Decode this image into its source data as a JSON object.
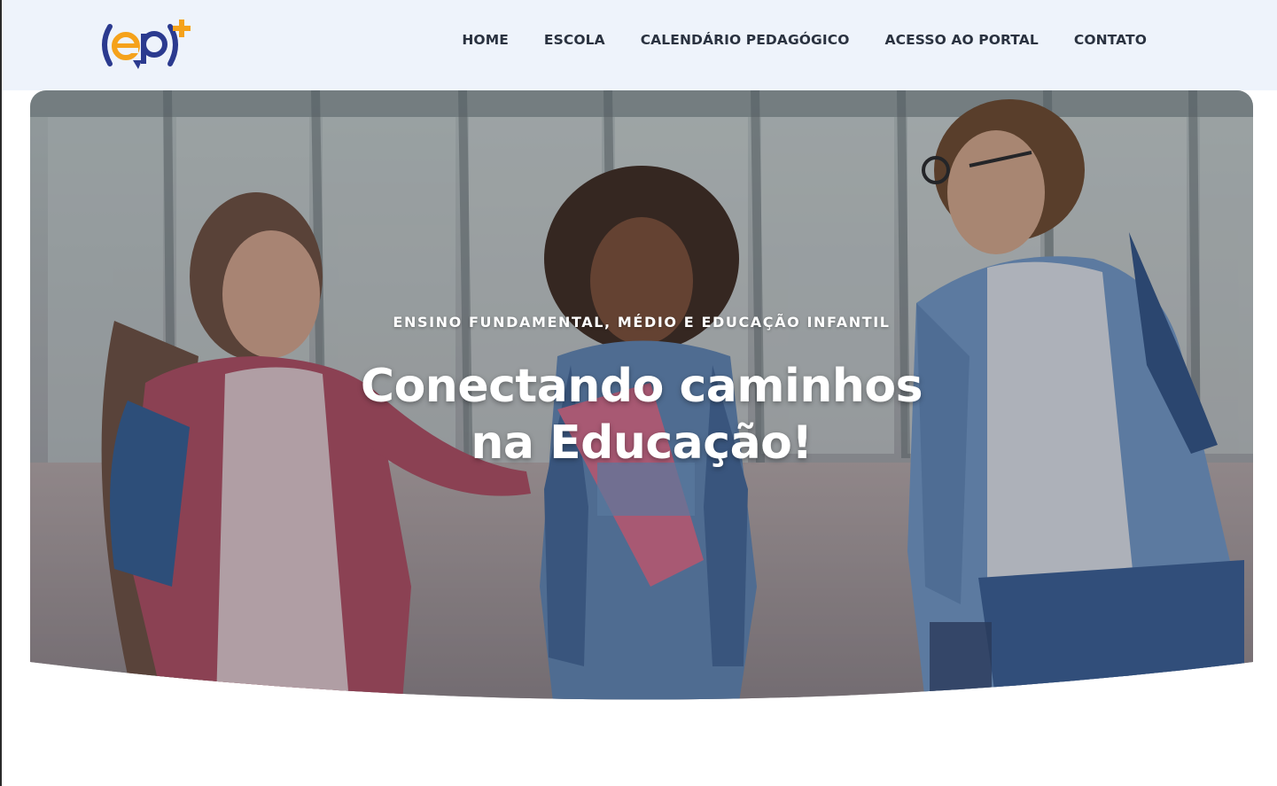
{
  "header": {
    "logo_alt": "ep+",
    "nav": [
      {
        "label": "HOME"
      },
      {
        "label": "ESCOLA"
      },
      {
        "label": "CALENDÁRIO PEDAGÓGICO"
      },
      {
        "label": "ACESSO AO PORTAL"
      },
      {
        "label": "CONTATO"
      }
    ]
  },
  "hero": {
    "subtitle": "ENSINO FUNDAMENTAL, MÉDIO E EDUCAÇÃO INFANTIL",
    "title_line1": "Conectando caminhos",
    "title_line2": "na Educação!",
    "image_description_icon": "students-photo"
  },
  "colors": {
    "header_bg": "#eef3fb",
    "nav_text": "#2a3240",
    "logo_blue": "#2b3a8f",
    "logo_orange": "#f5a21b",
    "hero_text": "#ffffff"
  }
}
